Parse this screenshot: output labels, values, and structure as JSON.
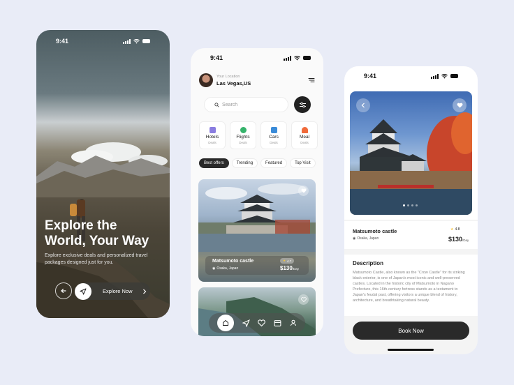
{
  "onboarding": {
    "time": "9:41",
    "title_line1": "Explore the",
    "title_line2": "World, Your Way",
    "subtitle": "Explore exclusive deals and personalized travel packages designed just for you.",
    "back_icon": "arrow-left-icon",
    "send_icon": "paper-plane-icon",
    "explore_label": "Explore Now",
    "chevron_icon": "chevron-right-icon"
  },
  "home": {
    "time": "9:41",
    "location_label": "Your Location",
    "location_value": "Las Vegas,US",
    "menu_icon": "menu-icon",
    "search_placeholder": "Search",
    "filter_icon": "sliders-icon",
    "categories": [
      {
        "name": "Hotels",
        "sub": "Deals",
        "icon": "hotel-icon",
        "color": "#8a7de0"
      },
      {
        "name": "Flights",
        "sub": "Deals",
        "icon": "plane-icon",
        "color": "#35b36b"
      },
      {
        "name": "Cars",
        "sub": "Deals",
        "icon": "car-icon",
        "color": "#3a8bd8"
      },
      {
        "name": "Meal",
        "sub": "Deals",
        "icon": "meal-icon",
        "color": "#f06a3a"
      }
    ],
    "tabs": [
      "Best offers",
      "Trending",
      "Featured",
      "Top Visit"
    ],
    "card1": {
      "title": "Matsumoto castle",
      "location": "Osaka, Japan",
      "rating": "4.7",
      "price": "$130",
      "per": "/Day"
    },
    "nav_icons": [
      "home-icon",
      "send-icon",
      "heart-icon",
      "calendar-icon",
      "user-icon"
    ]
  },
  "detail": {
    "time": "9:41",
    "title": "Matsumoto castle",
    "location": "Osaka, Japan",
    "rating": "4.8",
    "price": "$130",
    "per": "/Day",
    "desc_heading": "Description",
    "description": "Matsumoto Castle, also known as the \"Crow Castle\" for its striking black exterior, is one of Japan's most iconic and well-preserved castles. Located in the historic city of Matsumoto in Nagano Prefecture, this 16th-century fortress stands as a testament to Japan's feudal past, offering visitors a unique blend of history, architecture, and breathtaking natural beauty.",
    "book_label": "Book Now"
  }
}
